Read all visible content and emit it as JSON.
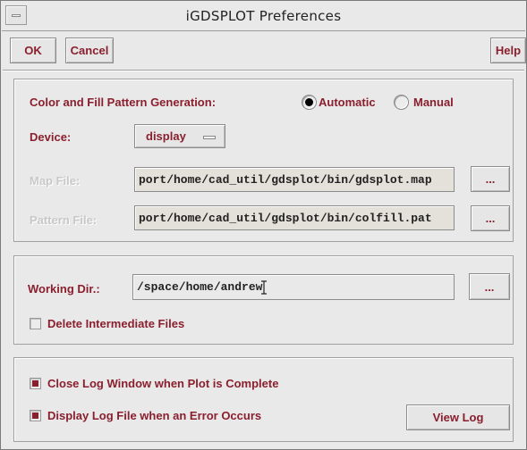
{
  "window": {
    "title": "iGDSPLOT Preferences"
  },
  "toolbar": {
    "ok_label": "OK",
    "cancel_label": "Cancel",
    "help_label": "Help"
  },
  "generation": {
    "label": "Color and Fill Pattern Generation:",
    "options": [
      {
        "label": "Automatic",
        "selected": true
      },
      {
        "label": "Manual",
        "selected": false
      }
    ]
  },
  "device": {
    "label": "Device:",
    "value": "display"
  },
  "map_file": {
    "label": "Map File:",
    "value": "port/home/cad_util/gdsplot/bin/gdsplot.map",
    "browse_label": "..."
  },
  "pattern_file": {
    "label": "Pattern File:",
    "value": "port/home/cad_util/gdsplot/bin/colfill.pat",
    "browse_label": "..."
  },
  "working_dir": {
    "label": "Working Dir.:",
    "value": "/space/home/andrew",
    "browse_label": "..."
  },
  "delete_intermediate": {
    "label": "Delete Intermediate Files",
    "checked": false
  },
  "close_log": {
    "label": "Close Log Window when Plot is Complete",
    "checked": true
  },
  "display_log": {
    "label": "Display Log File when an Error Occurs",
    "checked": true
  },
  "view_log": {
    "label": "View Log"
  },
  "colors": {
    "label": "#8a1f2e",
    "background": "#e9e9e9"
  }
}
